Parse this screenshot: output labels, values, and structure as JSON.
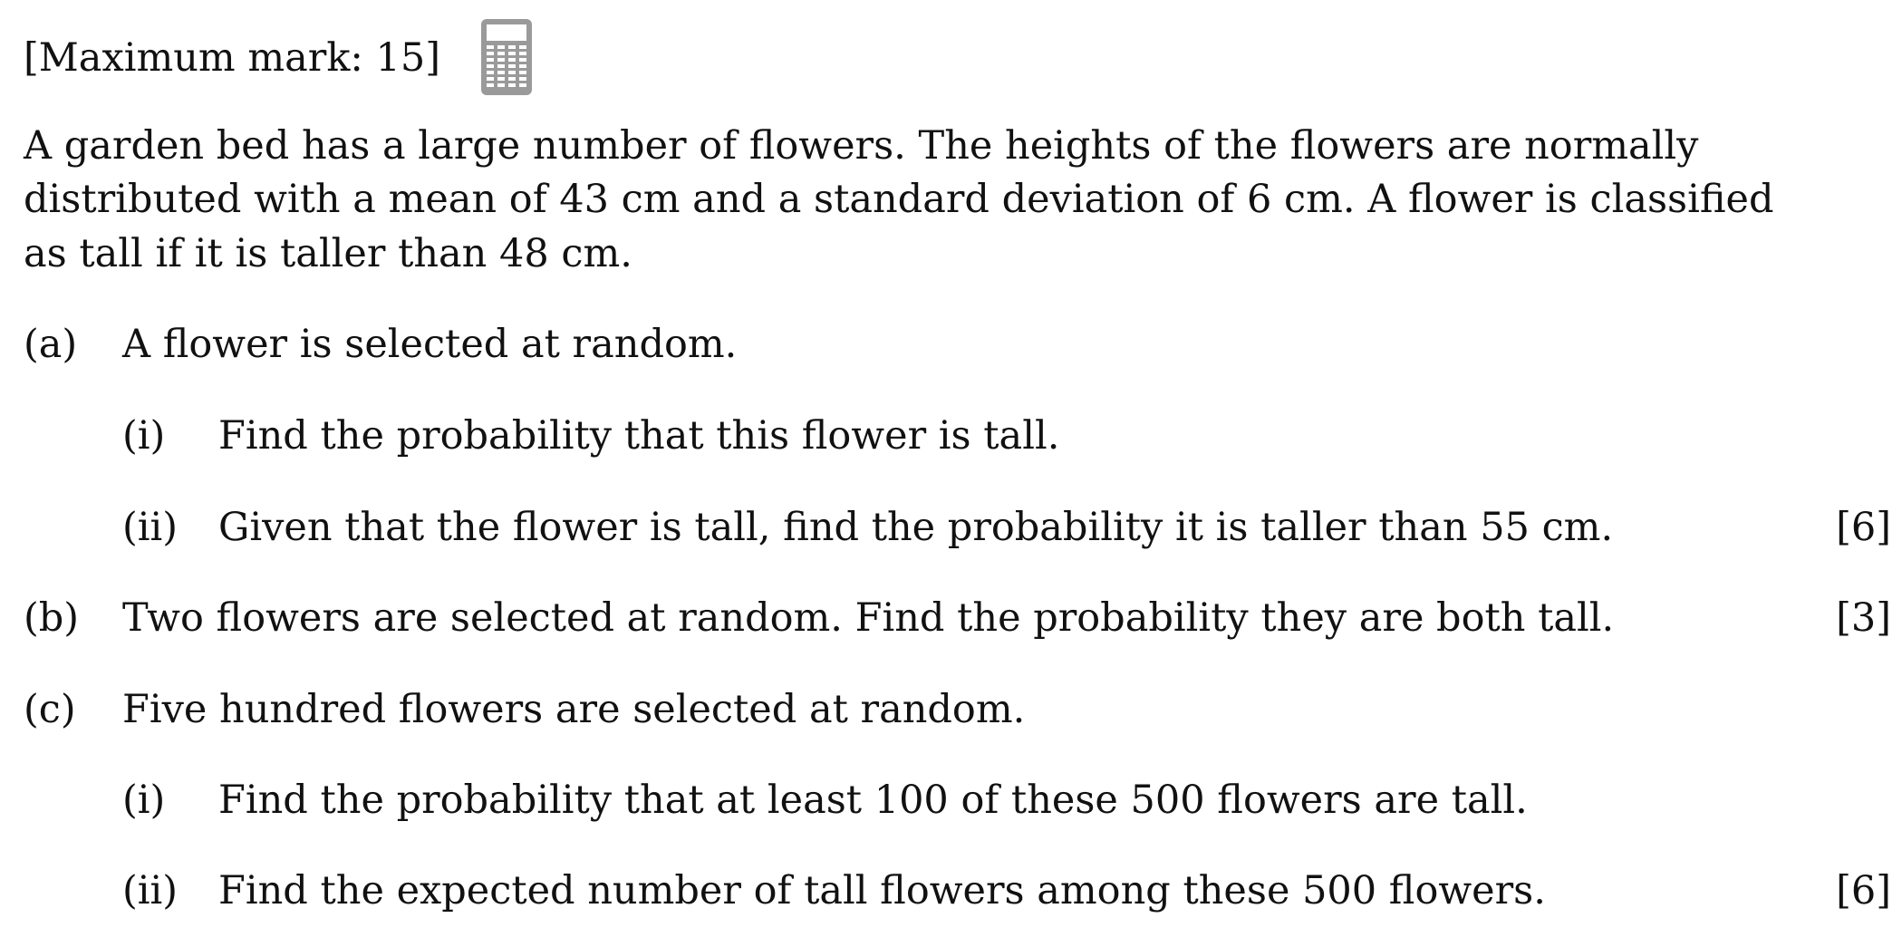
{
  "header": {
    "max_mark": "[Maximum mark: 15]",
    "calculator_icon": "calculator-icon"
  },
  "intro": {
    "line1": "A garden bed has a large number of flowers. The heights of the flowers are normally",
    "line2": "distributed with a mean of 43 cm and a standard deviation of 6 cm. A flower is classified",
    "line3": "as tall if it is taller than 48 cm."
  },
  "parts": {
    "a": {
      "label": "(a)",
      "text": "A flower is selected at random.",
      "i": {
        "label": "(i)",
        "text": "Find the probability that this flower is tall."
      },
      "ii": {
        "label": "(ii)",
        "text": "Given that the flower is tall, find the probability it is taller than 55 cm."
      },
      "marks": "[6]"
    },
    "b": {
      "label": "(b)",
      "text": "Two flowers are selected at random. Find the probability they are both tall.",
      "marks": "[3]"
    },
    "c": {
      "label": "(c)",
      "text": "Five hundred flowers are selected at random.",
      "i": {
        "label": "(i)",
        "text": "Find the probability that at least 100 of these 500 flowers are tall."
      },
      "ii": {
        "label": "(ii)",
        "text": "Find the expected number of tall flowers among these 500 flowers."
      },
      "marks": "[6]"
    }
  }
}
